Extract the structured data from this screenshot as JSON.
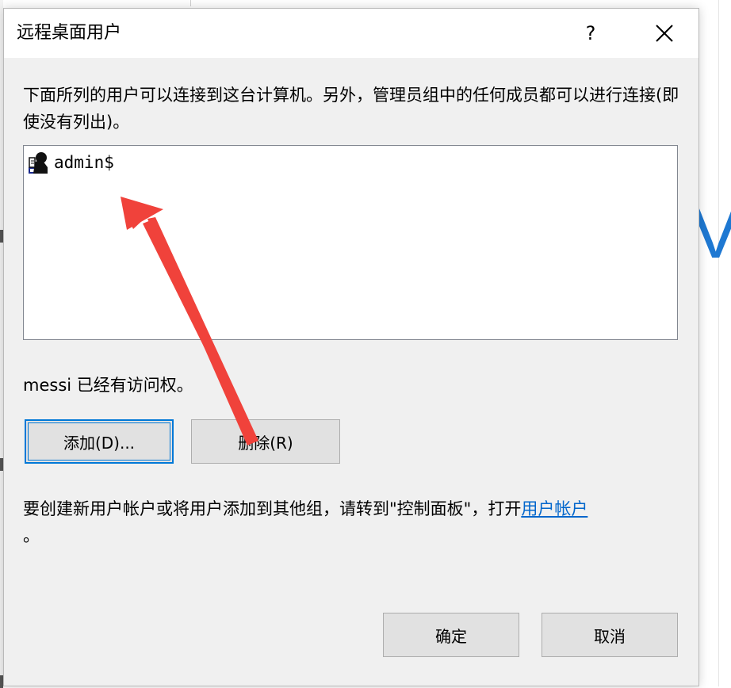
{
  "dialog": {
    "title": "远程桌面用户",
    "help_label": "?",
    "description": "下面所列的用户可以连接到这台计算机。另外，管理员组中的任何成员都可以进行连接(即使没有列出)。",
    "users": [
      {
        "name": "admin$",
        "icon": "user-icon"
      }
    ],
    "access_text": "messi 已经有访问权。",
    "add_button": "添加(D)...",
    "remove_button": "删除(R)",
    "info_text": "要创建新用户帐户或将用户添加到其他组，请转到\"控制面板\"，打开",
    "info_link": "用户帐户",
    "info_end": "。",
    "ok_button": "确定",
    "cancel_button": "取消"
  },
  "background": {
    "right_glyph": "V"
  },
  "colors": {
    "accent": "#0078d7",
    "link": "#0066cc",
    "annotation_arrow": "#f0423b"
  }
}
